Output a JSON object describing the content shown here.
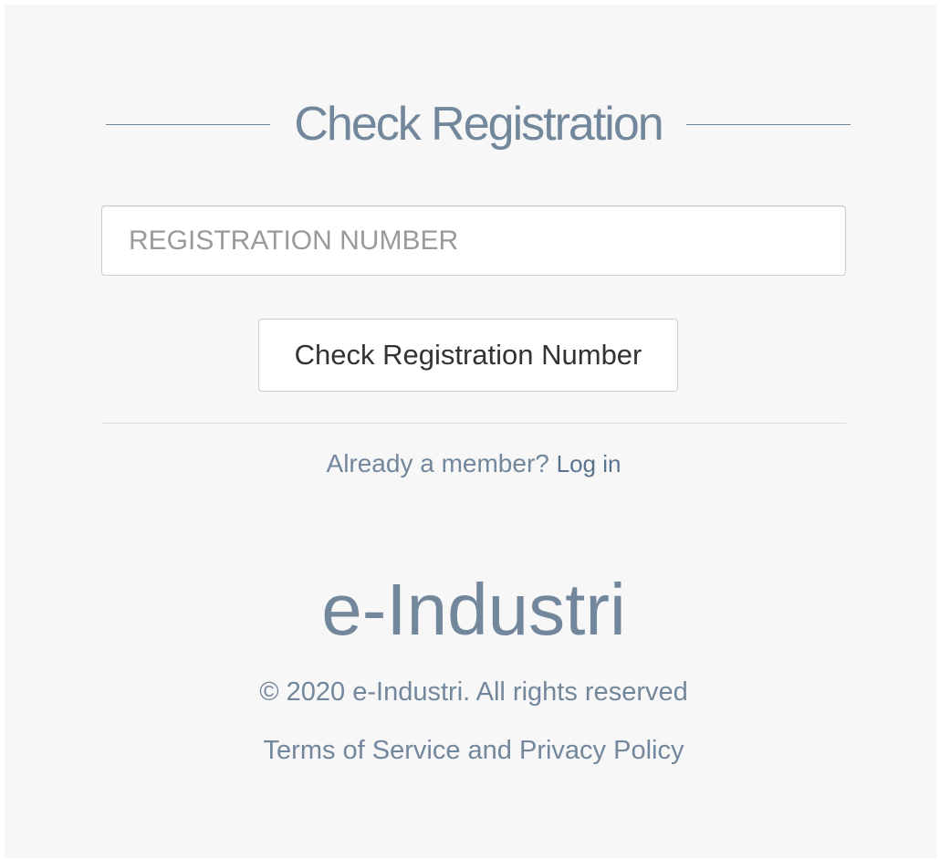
{
  "form": {
    "title": "Check Registration",
    "registration_input": {
      "value": "",
      "placeholder": "REGISTRATION NUMBER"
    },
    "submit_label": "Check Registration Number"
  },
  "member": {
    "prompt": "Already a member?",
    "login_label": "Log in"
  },
  "footer": {
    "brand": "e-Industri",
    "copyright": "© 2020 e-Industri. All rights reserved",
    "terms": "Terms of Service and Privacy Policy"
  },
  "colors": {
    "text_primary": "#73879c",
    "link": "#5a738e",
    "panel_background": "#f7f7f7"
  }
}
